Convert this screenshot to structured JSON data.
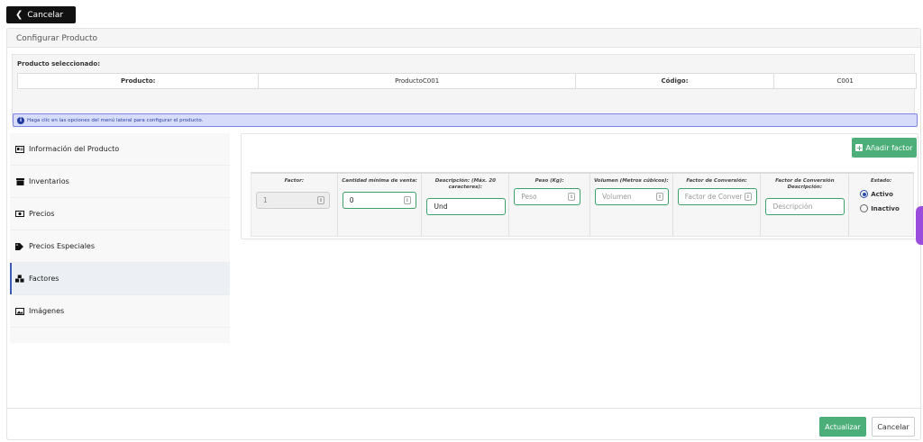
{
  "top_bar": {
    "cancel_label": "Cancelar"
  },
  "panel": {
    "title": "Configurar Producto"
  },
  "selected": {
    "heading": "Producto seleccionado:",
    "product_label": "Producto:",
    "product_value": "ProductoC001",
    "code_label": "Código:",
    "code_value": "C001"
  },
  "info": {
    "text": "Haga clic en las opciones del menú lateral para configurar el producto."
  },
  "sidebar": {
    "items": [
      {
        "label": "Información del Producto",
        "icon": "id-card-icon"
      },
      {
        "label": "Inventarios",
        "icon": "archive-box-icon"
      },
      {
        "label": "Precios",
        "icon": "money-bill-icon"
      },
      {
        "label": "Precios Especiales",
        "icon": "tags-icon"
      },
      {
        "label": "Factores",
        "icon": "cubes-icon",
        "active": true
      },
      {
        "label": "Imágenes",
        "icon": "image-icon"
      }
    ]
  },
  "factors": {
    "add_button": "Añadir factor",
    "columns": {
      "factor": "Factor:",
      "min_qty": "Cantidad mínima de venta:",
      "description": "Descripción: (Máx. 20 caracteres):",
      "weight": "Peso (Kg):",
      "volume": "Volumen (Metros cúbicos):",
      "conv_factor": "Factor de Conversión:",
      "conv_desc": "Factor de Conversión Descripción:",
      "status": "Estado:"
    },
    "row": {
      "factor_value": "1",
      "min_qty_value": "0",
      "description_value": "Und",
      "weight_placeholder": "Peso",
      "volume_placeholder": "Volumen",
      "conv_factor_placeholder": "Factor de Conver",
      "conv_desc_placeholder": "Descripción",
      "status_active": "Activo",
      "status_inactive": "Inactivo",
      "status_selected": "Activo"
    }
  },
  "footer": {
    "update_label": "Actualizar",
    "cancel_label": "Cancelar"
  },
  "colors": {
    "accent_green": "#4caf7a",
    "info_blue": "#d6dcfa",
    "side_tab_purple": "#9a4ddc"
  }
}
